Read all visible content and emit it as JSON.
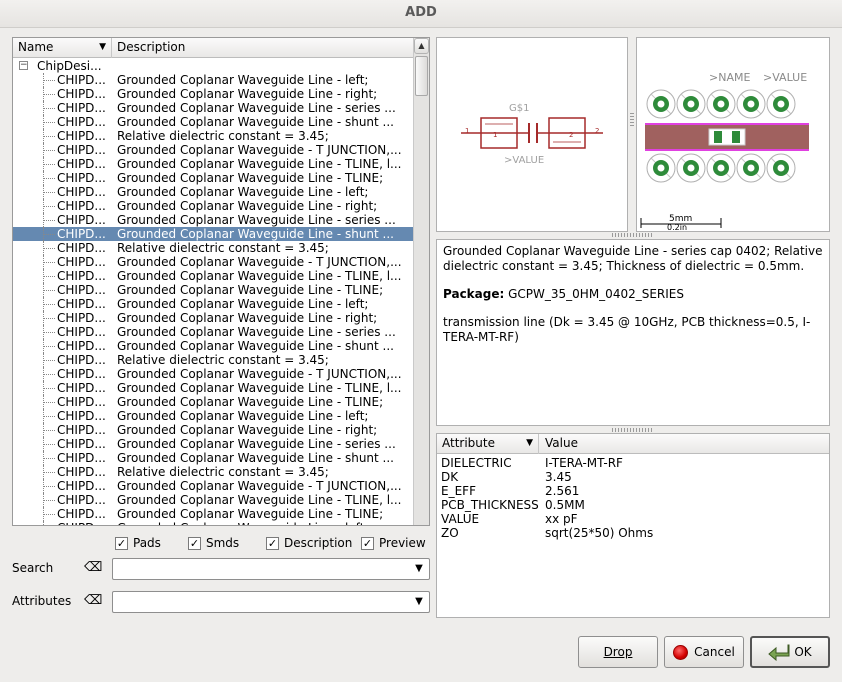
{
  "window": {
    "title": "ADD"
  },
  "tree": {
    "col_name": "Name",
    "col_desc": "Description",
    "root": "ChipDesi...",
    "selected_index": 11,
    "rows": [
      {
        "name": "CHIPD...",
        "desc": "Grounded Coplanar Waveguide Line - left;"
      },
      {
        "name": "CHIPD...",
        "desc": "Grounded Coplanar Waveguide Line - right;"
      },
      {
        "name": "CHIPD...",
        "desc": "Grounded Coplanar Waveguide Line - series ..."
      },
      {
        "name": "CHIPD...",
        "desc": "Grounded Coplanar Waveguide Line - shunt ..."
      },
      {
        "name": "CHIPD...",
        "desc": "Relative dielectric constant = 3.45;"
      },
      {
        "name": "CHIPD...",
        "desc": "Grounded Coplanar Waveguide - T JUNCTION,..."
      },
      {
        "name": "CHIPD...",
        "desc": "Grounded Coplanar Waveguide Line - TLINE, l..."
      },
      {
        "name": "CHIPD...",
        "desc": "Grounded Coplanar Waveguide Line - TLINE;"
      },
      {
        "name": "CHIPD...",
        "desc": "Grounded Coplanar Waveguide Line - left;"
      },
      {
        "name": "CHIPD...",
        "desc": "Grounded Coplanar Waveguide Line - right;"
      },
      {
        "name": "CHIPD...",
        "desc": "Grounded Coplanar Waveguide Line - series ..."
      },
      {
        "name": "CHIPD...",
        "desc": "Grounded Coplanar Waveguide Line - shunt ..."
      },
      {
        "name": "CHIPD...",
        "desc": "Relative dielectric constant = 3.45;"
      },
      {
        "name": "CHIPD...",
        "desc": "Grounded Coplanar Waveguide - T JUNCTION,..."
      },
      {
        "name": "CHIPD...",
        "desc": "Grounded Coplanar Waveguide Line - TLINE, l..."
      },
      {
        "name": "CHIPD...",
        "desc": "Grounded Coplanar Waveguide Line - TLINE;"
      },
      {
        "name": "CHIPD...",
        "desc": "Grounded Coplanar Waveguide Line - left;"
      },
      {
        "name": "CHIPD...",
        "desc": "Grounded Coplanar Waveguide Line - right;"
      },
      {
        "name": "CHIPD...",
        "desc": "Grounded Coplanar Waveguide Line - series ..."
      },
      {
        "name": "CHIPD...",
        "desc": "Grounded Coplanar Waveguide Line - shunt ..."
      },
      {
        "name": "CHIPD...",
        "desc": "Relative dielectric constant = 3.45;"
      },
      {
        "name": "CHIPD...",
        "desc": "Grounded Coplanar Waveguide - T JUNCTION,..."
      },
      {
        "name": "CHIPD...",
        "desc": "Grounded Coplanar Waveguide Line - TLINE, l..."
      },
      {
        "name": "CHIPD...",
        "desc": "Grounded Coplanar Waveguide Line - TLINE;"
      },
      {
        "name": "CHIPD...",
        "desc": "Grounded Coplanar Waveguide Line - left;"
      },
      {
        "name": "CHIPD...",
        "desc": "Grounded Coplanar Waveguide Line - right;"
      },
      {
        "name": "CHIPD...",
        "desc": "Grounded Coplanar Waveguide Line - series ..."
      },
      {
        "name": "CHIPD...",
        "desc": "Grounded Coplanar Waveguide Line - shunt ..."
      },
      {
        "name": "CHIPD...",
        "desc": "Relative dielectric constant = 3.45;"
      },
      {
        "name": "CHIPD...",
        "desc": "Grounded Coplanar Waveguide - T JUNCTION,..."
      },
      {
        "name": "CHIPD...",
        "desc": "Grounded Coplanar Waveguide Line - TLINE, l..."
      },
      {
        "name": "CHIPD...",
        "desc": "Grounded Coplanar Waveguide Line - TLINE;"
      },
      {
        "name": "CHIPD...",
        "desc": "Grounded Coplanar Waveguide Line - left;"
      }
    ]
  },
  "options": {
    "pads": "Pads",
    "smds": "Smds",
    "description": "Description",
    "preview": "Preview"
  },
  "search": {
    "label": "Search",
    "value": ""
  },
  "attributes_filter": {
    "label": "Attributes",
    "value": ""
  },
  "symbol_preview": {
    "name_text": "G$1",
    "value_text": ">VALUE",
    "pin1": "1",
    "pin2": "2",
    "pin1_inner": "1",
    "pin2_inner": "2"
  },
  "package_preview": {
    "name_text": ">NAME",
    "value_text": ">VALUE",
    "scale_metric": "5mm",
    "scale_imperial": "0.2in"
  },
  "info": {
    "description": "Grounded Coplanar Waveguide Line - series cap 0402; Relative dielectric constant = 3.45; Thickness of dielectric = 0.5mm.",
    "package_label": "Package:",
    "package_name": "GCPW_35_0HM_0402_SERIES",
    "notes": "transmission line (Dk = 3.45 @ 10GHz, PCB thickness=0.5, I-TERA-MT-RF)"
  },
  "attributes_table": {
    "col_attr": "Attribute",
    "col_value": "Value",
    "rows": [
      {
        "k": "DIELECTRIC",
        "v": "I-TERA-MT-RF"
      },
      {
        "k": "DK",
        "v": "3.45"
      },
      {
        "k": "E_EFF",
        "v": "2.561"
      },
      {
        "k": "PCB_THICKNESS",
        "v": "0.5MM"
      },
      {
        "k": "VALUE",
        "v": "xx pF"
      },
      {
        "k": "ZO",
        "v": "sqrt(25*50) Ohms"
      }
    ]
  },
  "buttons": {
    "drop": "Drop",
    "cancel": "Cancel",
    "ok": "OK"
  },
  "colors": {
    "selection": "#6589b1",
    "symbol": "#a52a2a",
    "pad_green": "#2e8b3a",
    "trace": "#a0615f",
    "magenta": "#e040e0"
  }
}
